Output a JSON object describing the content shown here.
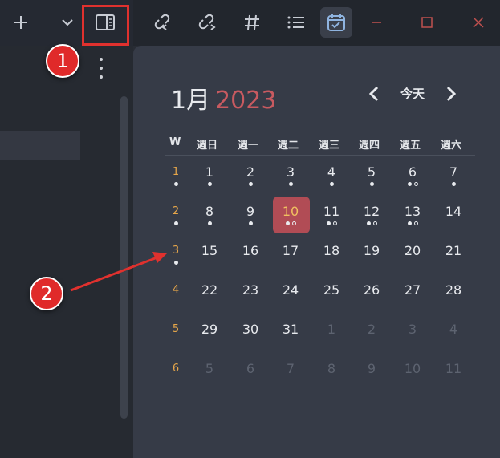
{
  "toolbar": {
    "icons": [
      "plus-icon",
      "chevron-down-icon",
      "sidebar-toggle-icon",
      "backlink-in-icon",
      "backlink-out-icon",
      "hashtag-icon",
      "list-icon",
      "calendar-icon"
    ]
  },
  "window": {
    "minimize": "–",
    "maximize": "□",
    "close": "×"
  },
  "calendar": {
    "month": "1月",
    "year": "2023",
    "today_label": "今天",
    "week_header": "W",
    "weekdays": [
      "週日",
      "週一",
      "週二",
      "週三",
      "週四",
      "週五",
      "週六"
    ],
    "weeks": [
      {
        "num": "1",
        "days": [
          "1",
          "2",
          "3",
          "4",
          "5",
          "6",
          "7"
        ]
      },
      {
        "num": "2",
        "days": [
          "8",
          "9",
          "10",
          "11",
          "12",
          "13",
          "14"
        ]
      },
      {
        "num": "3",
        "days": [
          "15",
          "16",
          "17",
          "18",
          "19",
          "20",
          "21"
        ]
      },
      {
        "num": "4",
        "days": [
          "22",
          "23",
          "24",
          "25",
          "26",
          "27",
          "28"
        ]
      },
      {
        "num": "5",
        "days": [
          "29",
          "30",
          "31",
          "1",
          "2",
          "3",
          "4"
        ]
      },
      {
        "num": "6",
        "days": [
          "5",
          "6",
          "7",
          "8",
          "9",
          "10",
          "11"
        ]
      }
    ]
  },
  "annotations": {
    "badge1": "1",
    "badge2": "2"
  },
  "colors": {
    "accent": "#b14c55",
    "year": "#c85a60",
    "week_number": "#e6a64a",
    "highlight": "#e0312e"
  }
}
